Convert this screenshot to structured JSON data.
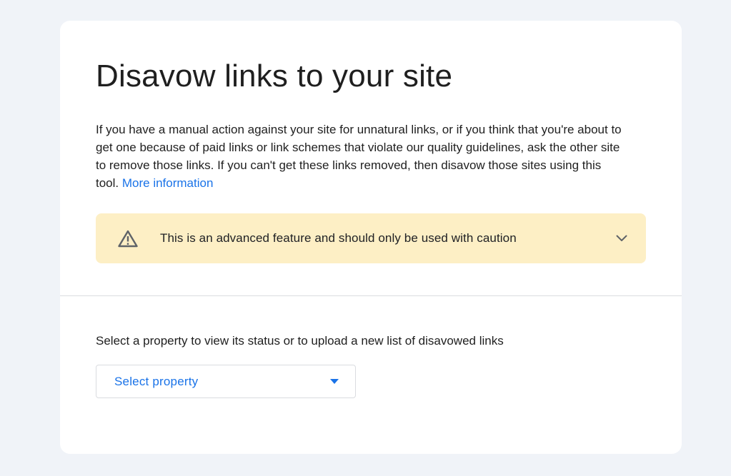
{
  "page": {
    "title": "Disavow links to your site",
    "intro_text": "If you have a manual action against your site for unnatural links, or if you think that you're about to get one because of paid links or link schemes that violate our quality guidelines, ask the other site to remove those links. If you can't get these links removed, then disavow those sites using this tool.",
    "more_info_link": "More information"
  },
  "warning": {
    "icon": "warning-triangle-icon",
    "text": "This is an advanced feature and should only be used with caution",
    "expand_icon": "chevron-down-icon",
    "background_color": "#fdefc5"
  },
  "property_selector": {
    "label": "Select a property to view its status or to upload a new list of disavowed links",
    "placeholder": "Select property",
    "dropdown_icon": "caret-down-icon"
  },
  "colors": {
    "accent": "#1a73e8",
    "page_background": "#f0f3f8",
    "card_background": "#ffffff"
  }
}
